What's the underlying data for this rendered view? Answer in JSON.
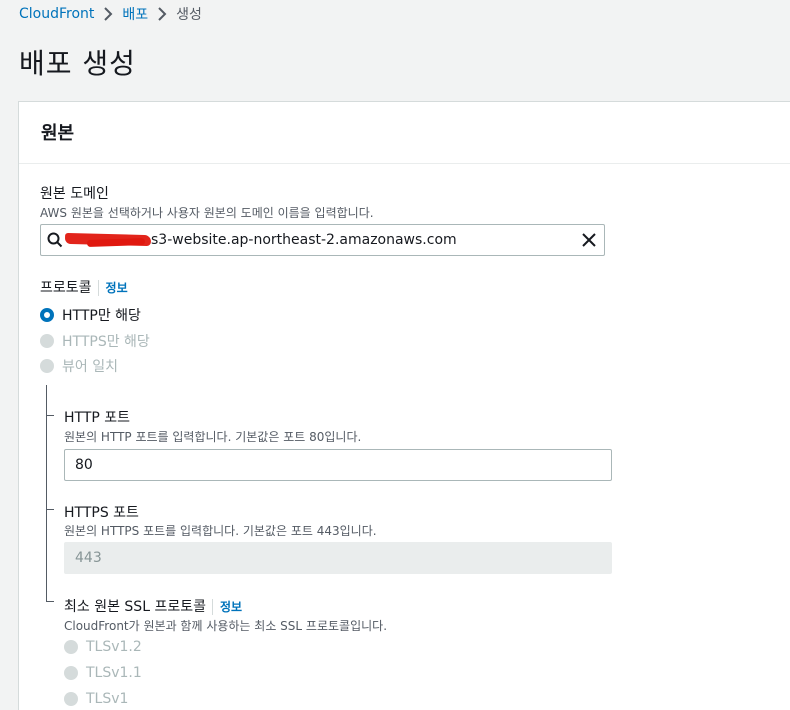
{
  "breadcrumb": {
    "items": [
      "CloudFront",
      "배포",
      "생성"
    ]
  },
  "page": {
    "title": "배포 생성"
  },
  "section": {
    "title": "원본"
  },
  "origin_domain": {
    "label": "원본 도메인",
    "description": "AWS 원본을 선택하거나 사용자 원본의 도메인 이름을 입력합니다.",
    "value": "s3-website.ap-northeast-2.amazonaws.com"
  },
  "protocol": {
    "label": "프로토콜",
    "info": "정보",
    "options": [
      {
        "label": "HTTP만 해당",
        "selected": true,
        "disabled": false
      },
      {
        "label": "HTTPS만 해당",
        "selected": false,
        "disabled": true
      },
      {
        "label": "뷰어 일치",
        "selected": false,
        "disabled": true
      }
    ]
  },
  "http_port": {
    "label": "HTTP 포트",
    "description": "원본의 HTTP 포트를 입력합니다. 기본값은 포트 80입니다.",
    "value": "80"
  },
  "https_port": {
    "label": "HTTPS 포트",
    "description": "원본의 HTTPS 포트를 입력합니다. 기본값은 포트 443입니다.",
    "value": "443"
  },
  "ssl_protocol": {
    "label": "최소 원본 SSL 프로토콜",
    "info": "정보",
    "description": "CloudFront가 원본과 함께 사용하는 최소 SSL 프로토콜입니다.",
    "options": [
      {
        "label": "TLSv1.2",
        "disabled": true
      },
      {
        "label": "TLSv1.1",
        "disabled": true
      },
      {
        "label": "TLSv1",
        "disabled": true
      }
    ]
  },
  "colors": {
    "link": "#0073bb",
    "text": "#16191f",
    "muted": "#545b64",
    "disabled": "#aab7b8",
    "redaction": "#e0180f"
  }
}
